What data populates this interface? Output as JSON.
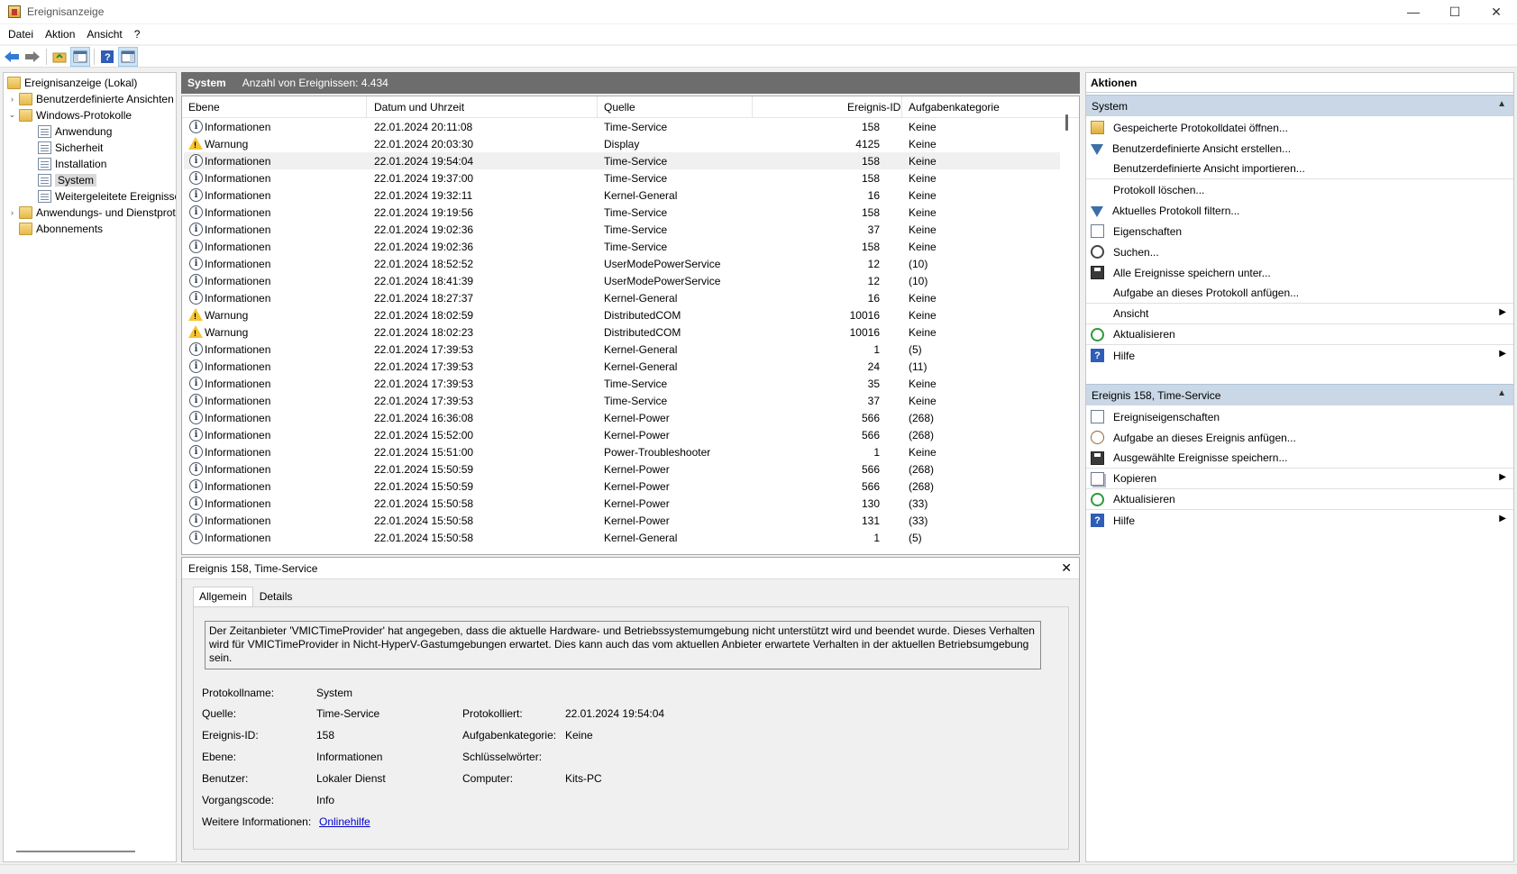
{
  "window": {
    "title": "Ereignisanzeige"
  },
  "menu": [
    "Datei",
    "Aktion",
    "Ansicht",
    "?"
  ],
  "toolbar_icons": [
    "back-arrow-icon",
    "forward-arrow-icon",
    "folder-up-icon",
    "show-hide-tree-icon",
    "help-icon",
    "action-pane-icon"
  ],
  "tree": {
    "root": "Ereignisanzeige (Lokal)",
    "custom_views": "Benutzerdefinierte Ansichten",
    "windows_logs": "Windows-Protokolle",
    "log_application": "Anwendung",
    "log_security": "Sicherheit",
    "log_setup": "Installation",
    "log_system": "System",
    "log_forwarded": "Weitergeleitete Ereignisse",
    "app_service_logs": "Anwendungs- und Dienstprotokolle",
    "subscriptions": "Abonnements"
  },
  "center": {
    "log_name": "System",
    "event_count": "Anzahl von Ereignissen: 4.434",
    "columns": [
      "Ebene",
      "Datum und Uhrzeit",
      "Quelle",
      "Ereignis-ID",
      "Aufgabenkategorie"
    ],
    "rows": [
      {
        "level": "Informationen",
        "type": "info",
        "date": "22.01.2024 20:11:08",
        "source": "Time-Service",
        "id": "158",
        "cat": "Keine"
      },
      {
        "level": "Warnung",
        "type": "warn",
        "date": "22.01.2024 20:03:30",
        "source": "Display",
        "id": "4125",
        "cat": "Keine"
      },
      {
        "level": "Informationen",
        "type": "info",
        "date": "22.01.2024 19:54:04",
        "source": "Time-Service",
        "id": "158",
        "cat": "Keine"
      },
      {
        "level": "Informationen",
        "type": "info",
        "date": "22.01.2024 19:37:00",
        "source": "Time-Service",
        "id": "158",
        "cat": "Keine"
      },
      {
        "level": "Informationen",
        "type": "info",
        "date": "22.01.2024 19:32:11",
        "source": "Kernel-General",
        "id": "16",
        "cat": "Keine"
      },
      {
        "level": "Informationen",
        "type": "info",
        "date": "22.01.2024 19:19:56",
        "source": "Time-Service",
        "id": "158",
        "cat": "Keine"
      },
      {
        "level": "Informationen",
        "type": "info",
        "date": "22.01.2024 19:02:36",
        "source": "Time-Service",
        "id": "37",
        "cat": "Keine"
      },
      {
        "level": "Informationen",
        "type": "info",
        "date": "22.01.2024 19:02:36",
        "source": "Time-Service",
        "id": "158",
        "cat": "Keine"
      },
      {
        "level": "Informationen",
        "type": "info",
        "date": "22.01.2024 18:52:52",
        "source": "UserModePowerService",
        "id": "12",
        "cat": "(10)"
      },
      {
        "level": "Informationen",
        "type": "info",
        "date": "22.01.2024 18:41:39",
        "source": "UserModePowerService",
        "id": "12",
        "cat": "(10)"
      },
      {
        "level": "Informationen",
        "type": "info",
        "date": "22.01.2024 18:27:37",
        "source": "Kernel-General",
        "id": "16",
        "cat": "Keine"
      },
      {
        "level": "Warnung",
        "type": "warn",
        "date": "22.01.2024 18:02:59",
        "source": "DistributedCOM",
        "id": "10016",
        "cat": "Keine"
      },
      {
        "level": "Warnung",
        "type": "warn",
        "date": "22.01.2024 18:02:23",
        "source": "DistributedCOM",
        "id": "10016",
        "cat": "Keine"
      },
      {
        "level": "Informationen",
        "type": "info",
        "date": "22.01.2024 17:39:53",
        "source": "Kernel-General",
        "id": "1",
        "cat": "(5)"
      },
      {
        "level": "Informationen",
        "type": "info",
        "date": "22.01.2024 17:39:53",
        "source": "Kernel-General",
        "id": "24",
        "cat": "(11)"
      },
      {
        "level": "Informationen",
        "type": "info",
        "date": "22.01.2024 17:39:53",
        "source": "Time-Service",
        "id": "35",
        "cat": "Keine"
      },
      {
        "level": "Informationen",
        "type": "info",
        "date": "22.01.2024 17:39:53",
        "source": "Time-Service",
        "id": "37",
        "cat": "Keine"
      },
      {
        "level": "Informationen",
        "type": "info",
        "date": "22.01.2024 16:36:08",
        "source": "Kernel-Power",
        "id": "566",
        "cat": "(268)"
      },
      {
        "level": "Informationen",
        "type": "info",
        "date": "22.01.2024 15:52:00",
        "source": "Kernel-Power",
        "id": "566",
        "cat": "(268)"
      },
      {
        "level": "Informationen",
        "type": "info",
        "date": "22.01.2024 15:51:00",
        "source": "Power-Troubleshooter",
        "id": "1",
        "cat": "Keine"
      },
      {
        "level": "Informationen",
        "type": "info",
        "date": "22.01.2024 15:50:59",
        "source": "Kernel-Power",
        "id": "566",
        "cat": "(268)"
      },
      {
        "level": "Informationen",
        "type": "info",
        "date": "22.01.2024 15:50:59",
        "source": "Kernel-Power",
        "id": "566",
        "cat": "(268)"
      },
      {
        "level": "Informationen",
        "type": "info",
        "date": "22.01.2024 15:50:58",
        "source": "Kernel-Power",
        "id": "130",
        "cat": "(33)"
      },
      {
        "level": "Informationen",
        "type": "info",
        "date": "22.01.2024 15:50:58",
        "source": "Kernel-Power",
        "id": "131",
        "cat": "(33)"
      },
      {
        "level": "Informationen",
        "type": "info",
        "date": "22.01.2024 15:50:58",
        "source": "Kernel-General",
        "id": "1",
        "cat": "(5)"
      }
    ],
    "selected_row": 2
  },
  "detail": {
    "title": "Ereignis 158, Time-Service",
    "tab_general": "Allgemein",
    "tab_details": "Details",
    "description": "Der Zeitanbieter 'VMICTimeProvider' hat angegeben, dass die aktuelle Hardware- und Betriebssystemumgebung nicht unterstützt wird und beendet wurde. Dieses Verhalten wird für VMICTimeProvider in Nicht-HyperV-Gastumgebungen erwartet. Dies kann auch das vom aktuellen Anbieter erwartete Verhalten in der aktuellen Betriebsumgebung sein.",
    "labels": {
      "log_name": "Protokollname:",
      "source": "Quelle:",
      "event_id": "Ereignis-ID:",
      "level": "Ebene:",
      "user": "Benutzer:",
      "opcode": "Vorgangscode:",
      "more_info": "Weitere Informationen:",
      "logged": "Protokolliert:",
      "task_cat": "Aufgabenkategorie:",
      "keywords": "Schlüsselwörter:",
      "computer": "Computer:"
    },
    "values": {
      "log_name": "System",
      "source": "Time-Service",
      "event_id": "158",
      "level": "Informationen",
      "user": "Lokaler Dienst",
      "opcode": "Info",
      "more_info": "Onlinehilfe",
      "logged": "22.01.2024 19:54:04",
      "task_cat": "Keine",
      "keywords": "",
      "computer": "Kits-PC"
    }
  },
  "actions": {
    "header": "Aktionen",
    "section_system": "System",
    "system_items": [
      {
        "label": "Gespeicherte Protokolldatei öffnen...",
        "icon": "open-log-icon"
      },
      {
        "label": "Benutzerdefinierte Ansicht erstellen...",
        "icon": "create-view-filter-icon"
      },
      {
        "label": "Benutzerdefinierte Ansicht importieren...",
        "icon": ""
      },
      {
        "label": "Protokoll löschen...",
        "icon": ""
      },
      {
        "label": "Aktuelles Protokoll filtern...",
        "icon": "filter-icon"
      },
      {
        "label": "Eigenschaften",
        "icon": "properties-icon"
      },
      {
        "label": "Suchen...",
        "icon": "find-icon"
      },
      {
        "label": "Alle Ereignisse speichern unter...",
        "icon": "save-icon"
      },
      {
        "label": "Aufgabe an dieses Protokoll anfügen...",
        "icon": ""
      },
      {
        "label": "Ansicht",
        "icon": "",
        "submenu": true
      },
      {
        "label": "Aktualisieren",
        "icon": "refresh-icon"
      },
      {
        "label": "Hilfe",
        "icon": "help-icon",
        "submenu": true
      }
    ],
    "section_event": "Ereignis 158, Time-Service",
    "event_items": [
      {
        "label": "Ereigniseigenschaften",
        "icon": "event-properties-icon"
      },
      {
        "label": "Aufgabe an dieses Ereignis anfügen...",
        "icon": "attach-task-icon"
      },
      {
        "label": "Ausgewählte Ereignisse speichern...",
        "icon": "save-icon"
      },
      {
        "label": "Kopieren",
        "icon": "copy-icon",
        "submenu": true
      },
      {
        "label": "Aktualisieren",
        "icon": "refresh-icon"
      },
      {
        "label": "Hilfe",
        "icon": "help-icon",
        "submenu": true
      }
    ]
  }
}
